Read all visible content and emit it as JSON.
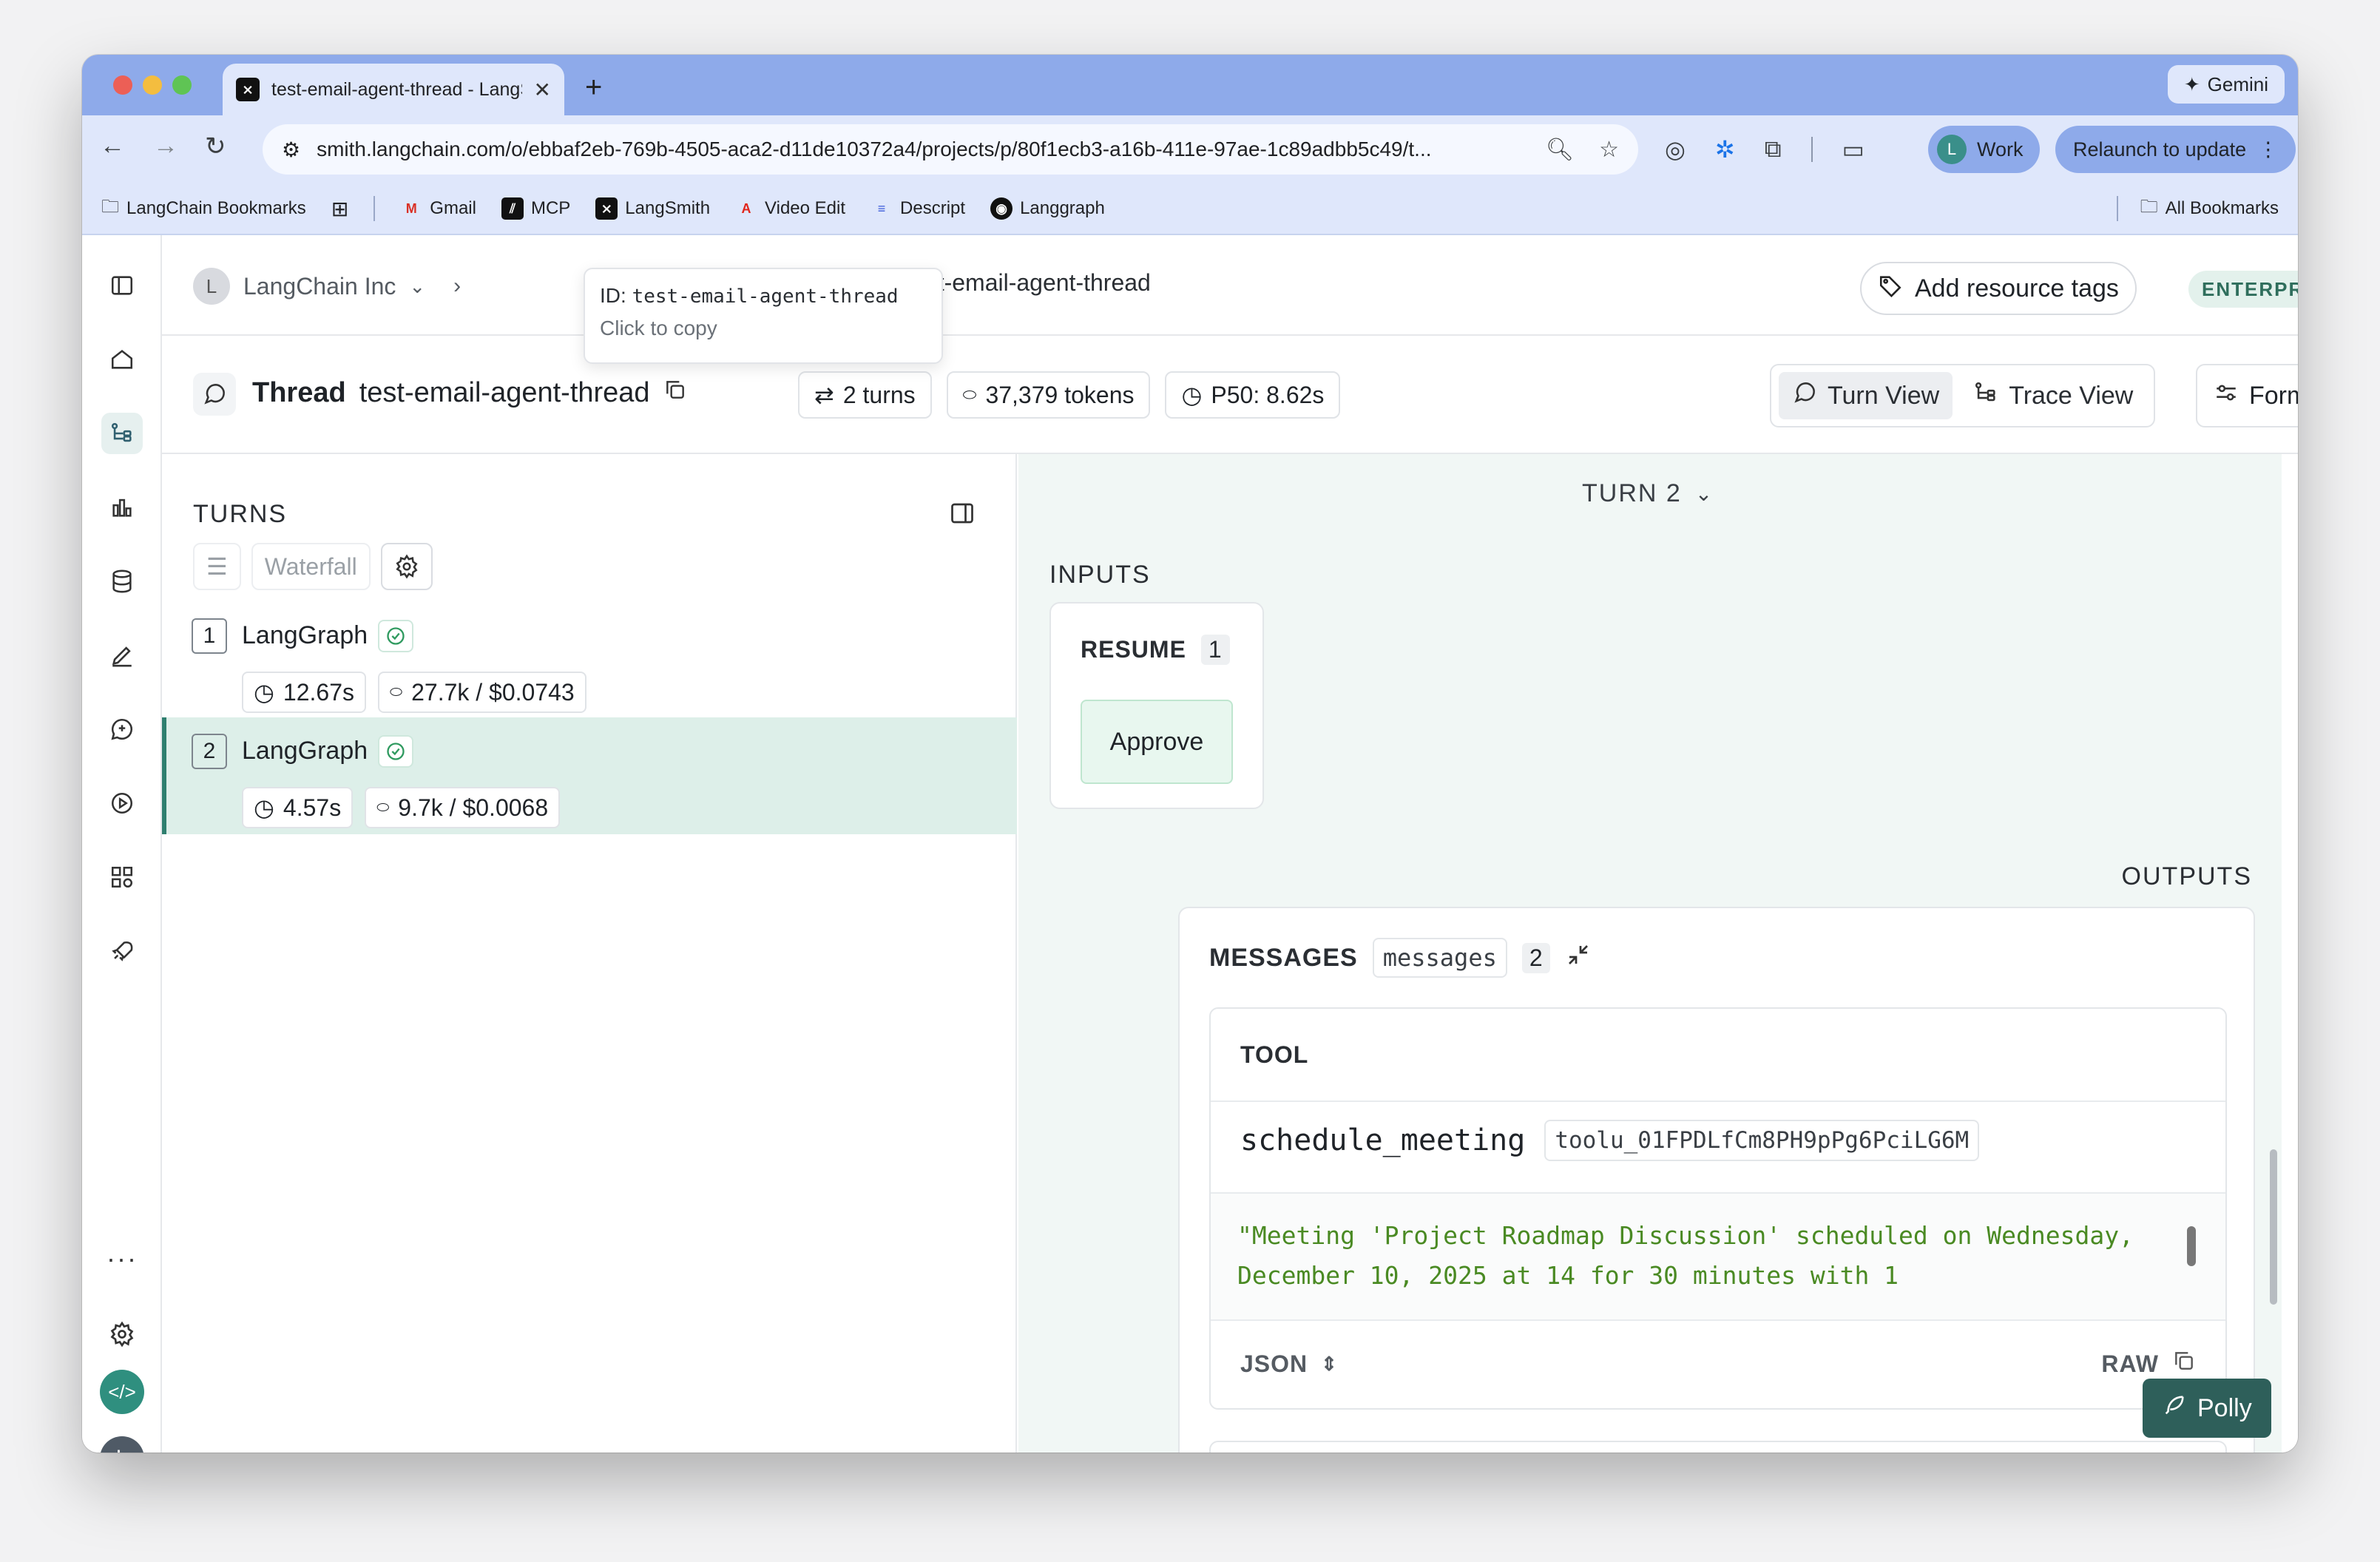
{
  "browser": {
    "tab_title": "test-email-agent-thread - LangSmith",
    "gemini_label": "Gemini",
    "url": "smith.langchain.com/o/ebbaf2eb-769b-4505-aca2-d11de10372a4/projects/p/80f1ecb3-a16b-411e-97ae-1c89adbb5c49/t...",
    "profile_label": "Work",
    "profile_initial": "L",
    "relaunch_label": "Relaunch to update"
  },
  "bookmarks": {
    "items": [
      "LangChain Bookmarks",
      "Gmail",
      "MCP",
      "LangSmith",
      "Video Edit",
      "Descript",
      "Langgraph"
    ],
    "all_label": "All Bookmarks"
  },
  "app": {
    "org_name": "LangChain Inc",
    "org_initial": "L",
    "user_initial": "L",
    "thread_crumb": "test-email-agent-thread",
    "tooltip": {
      "id_label": "ID:",
      "id_value": "test-email-agent-thread",
      "hint": "Click to copy"
    },
    "add_tags_label": "Add resource tags",
    "plan_badge": "ENTERPRISE"
  },
  "thread": {
    "label": "Thread",
    "name": "test-email-agent-thread",
    "turns": "2 turns",
    "tokens": "37,379 tokens",
    "p50": "P50: 8.62s",
    "views": [
      "Turn View",
      "Trace View"
    ],
    "active_view": "Turn View",
    "format_label": "Format"
  },
  "turns_panel": {
    "heading": "TURNS",
    "view_mode": "Waterfall",
    "turns": [
      {
        "num": "1",
        "name": "LangGraph",
        "latency": "12.67s",
        "tokens_cost": "27.7k / $0.0743",
        "status": "success"
      },
      {
        "num": "2",
        "name": "LangGraph",
        "latency": "4.57s",
        "tokens_cost": "9.7k / $0.0068",
        "status": "success"
      }
    ],
    "selected_turn": "2"
  },
  "detail": {
    "turn_selector": "TURN 2",
    "inputs_label": "INPUTS",
    "resume_label": "RESUME",
    "resume_count": "1",
    "resume_value": "Approve",
    "outputs_label": "OUTPUTS",
    "messages_label": "MESSAGES",
    "messages_key": "messages",
    "messages_count": "2",
    "tool_role": "TOOL",
    "tool_name": "schedule_meeting",
    "tool_call_id": "toolu_01FPDLfCm8PH9pPg6PciLG6M",
    "tool_output": "\"Meeting 'Project Roadmap Discussion' scheduled on Wednesday, December 10, 2025 at 14 for 30 minutes with 1",
    "format_label": "JSON",
    "raw_label": "RAW"
  },
  "assistant": {
    "label": "Polly"
  },
  "colors": {
    "accent": "#2f7f6f",
    "selected_row": "#ddefe9",
    "detail_bg": "#f1f7f5",
    "tool_output_text": "#4a8a23",
    "polly_bg": "#2e5f5a"
  }
}
